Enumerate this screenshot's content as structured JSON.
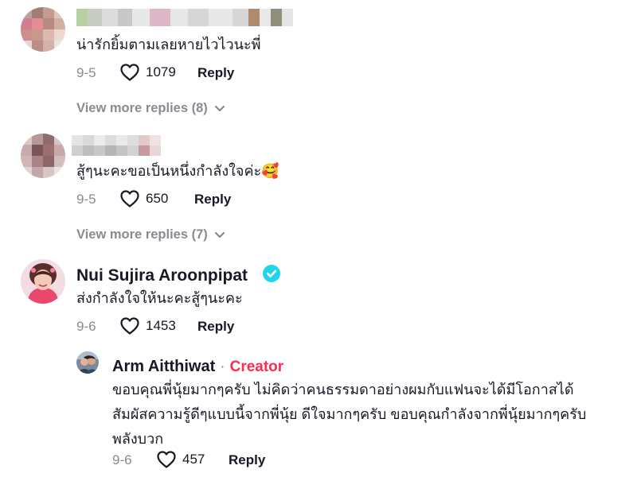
{
  "comments": [
    {
      "text": "น่ารักยิ้มตามเลยหายไวไวนะพี่",
      "date": "9-5",
      "likes": "1079",
      "reply_label": "Reply",
      "view_more": "View more replies (8)"
    },
    {
      "text": "สู้ๆนะคะขอเป็นหนึ่งกำลังใจค่ะ🥰",
      "date": "9-5",
      "likes": "650",
      "reply_label": "Reply",
      "view_more": "View more replies (7)"
    },
    {
      "author": "Nui Sujira Aroonpipat",
      "verified": true,
      "text": "ส่งกำลังใจให้นะคะสู้ๆนะคะ",
      "date": "9-6",
      "likes": "1453",
      "reply_label": "Reply"
    }
  ],
  "reply": {
    "author": "Arm Aitthiwat",
    "separator": "·",
    "badge": "Creator",
    "text_lines": [
      "ขอบคุณพี่นุ้ยมากๆครับ ไม่คิดว่าคนธรรมดาอย่างผมกับแฟนจะได้มีโอกาสได้",
      "สัมผัสความรู้ดีๆแบบนี้จากพี่นุ้ย ดีใจมากๆครับ ขอบคุณกำลังจากพี่นุ้ยมากๆครับ",
      "พลังบวก"
    ],
    "date": "9-6",
    "likes": "457",
    "reply_label": "Reply"
  },
  "colors": {
    "accent": "#fe2c55",
    "verified": "#20d5ec",
    "muted": "#8a8b91"
  }
}
